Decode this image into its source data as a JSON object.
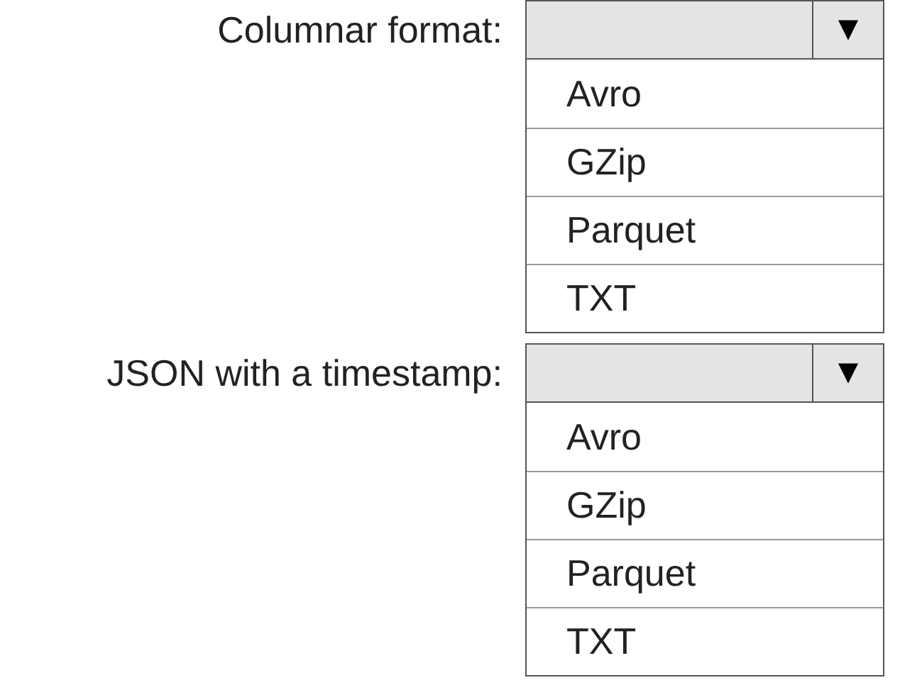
{
  "questions": [
    {
      "label": "Columnar format:",
      "arrow": "▼",
      "options": [
        {
          "label": "Avro"
        },
        {
          "label": "GZip"
        },
        {
          "label": "Parquet"
        },
        {
          "label": "TXT"
        }
      ]
    },
    {
      "label": "JSON with a timestamp:",
      "arrow": "▼",
      "options": [
        {
          "label": "Avro"
        },
        {
          "label": "GZip"
        },
        {
          "label": "Parquet"
        },
        {
          "label": "TXT"
        }
      ]
    }
  ]
}
